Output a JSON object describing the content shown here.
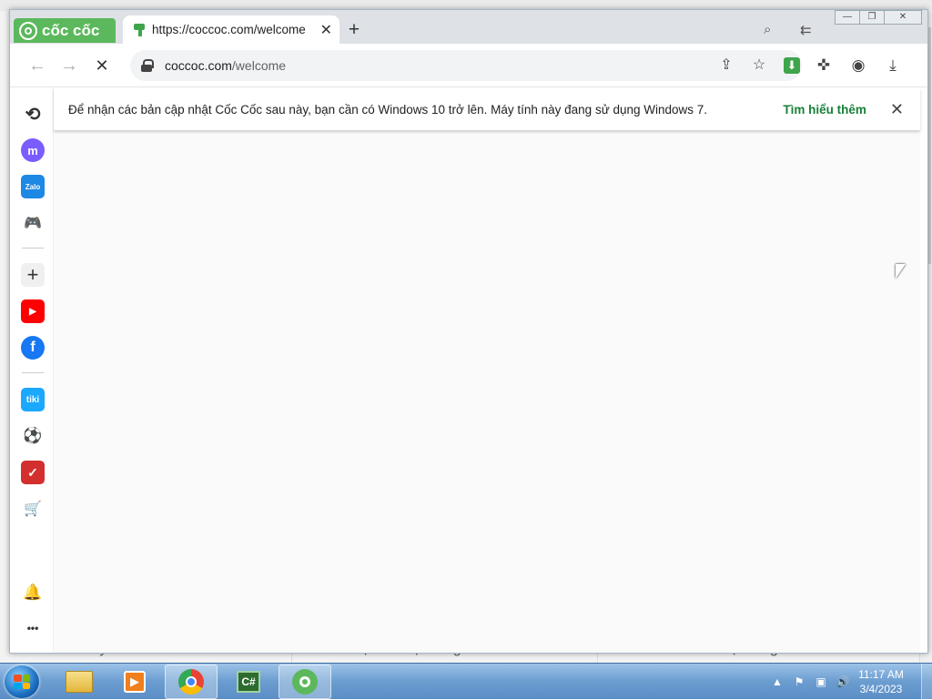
{
  "browser": {
    "brand": "cốc cốc",
    "tab": {
      "title": "https://coccoc.com/welcome",
      "close_label": "✕"
    },
    "new_tab_label": "+",
    "window_controls": {
      "minimize": "—",
      "restore": "❐",
      "close": "✕"
    }
  },
  "toolbar": {
    "url_host": "coccoc.com",
    "url_path": "/welcome",
    "back": "←",
    "forward": "→",
    "stop": "✕"
  },
  "sidebar": {
    "items": [
      {
        "name": "history",
        "label": "⟲",
        "color": "#333333"
      },
      {
        "name": "messenger",
        "label": "m",
        "color": "#7b5cff"
      },
      {
        "name": "zalo",
        "label": "Zalo",
        "color": "#1e88e5"
      },
      {
        "name": "games",
        "label": "🎮",
        "color": "#4caf50"
      },
      {
        "name": "add",
        "label": "+",
        "color": "#333333"
      },
      {
        "name": "youtube",
        "label": "▶",
        "color": "#ff0000"
      },
      {
        "name": "facebook",
        "label": "f",
        "color": "#1877f2"
      },
      {
        "name": "tiki",
        "label": "tiki",
        "color": "#1ba8ff"
      },
      {
        "name": "soccer",
        "label": "⚽",
        "color": "#2e7d32"
      },
      {
        "name": "todo",
        "label": "✓",
        "color": "#d32f2f"
      },
      {
        "name": "shopping",
        "label": "🛒",
        "color": "#f57c00"
      }
    ],
    "notification": "🔔",
    "more": "•••"
  },
  "infobar": {
    "message": "Để nhận các bản cập nhật Cốc Cốc sau này, bạn cần có Windows 10 trở lên. Máy tính này đang sử dụng Windows 7.",
    "learn_more": "Tìm hiểu thêm",
    "close": "✕"
  },
  "background_page": {
    "snippets": [
      "của sổ này.",
      "thoại của hệ thống.",
      "Thờ khi cài đặt xong."
    ]
  },
  "taskbar": {
    "apps": [
      "explorer",
      "media",
      "chrome",
      "csharp",
      "coccoc"
    ],
    "clock_time": "11:17 AM",
    "clock_date": "3/4/2023"
  },
  "colors": {
    "accent": "#3fa54a",
    "learn_link": "#188038"
  }
}
